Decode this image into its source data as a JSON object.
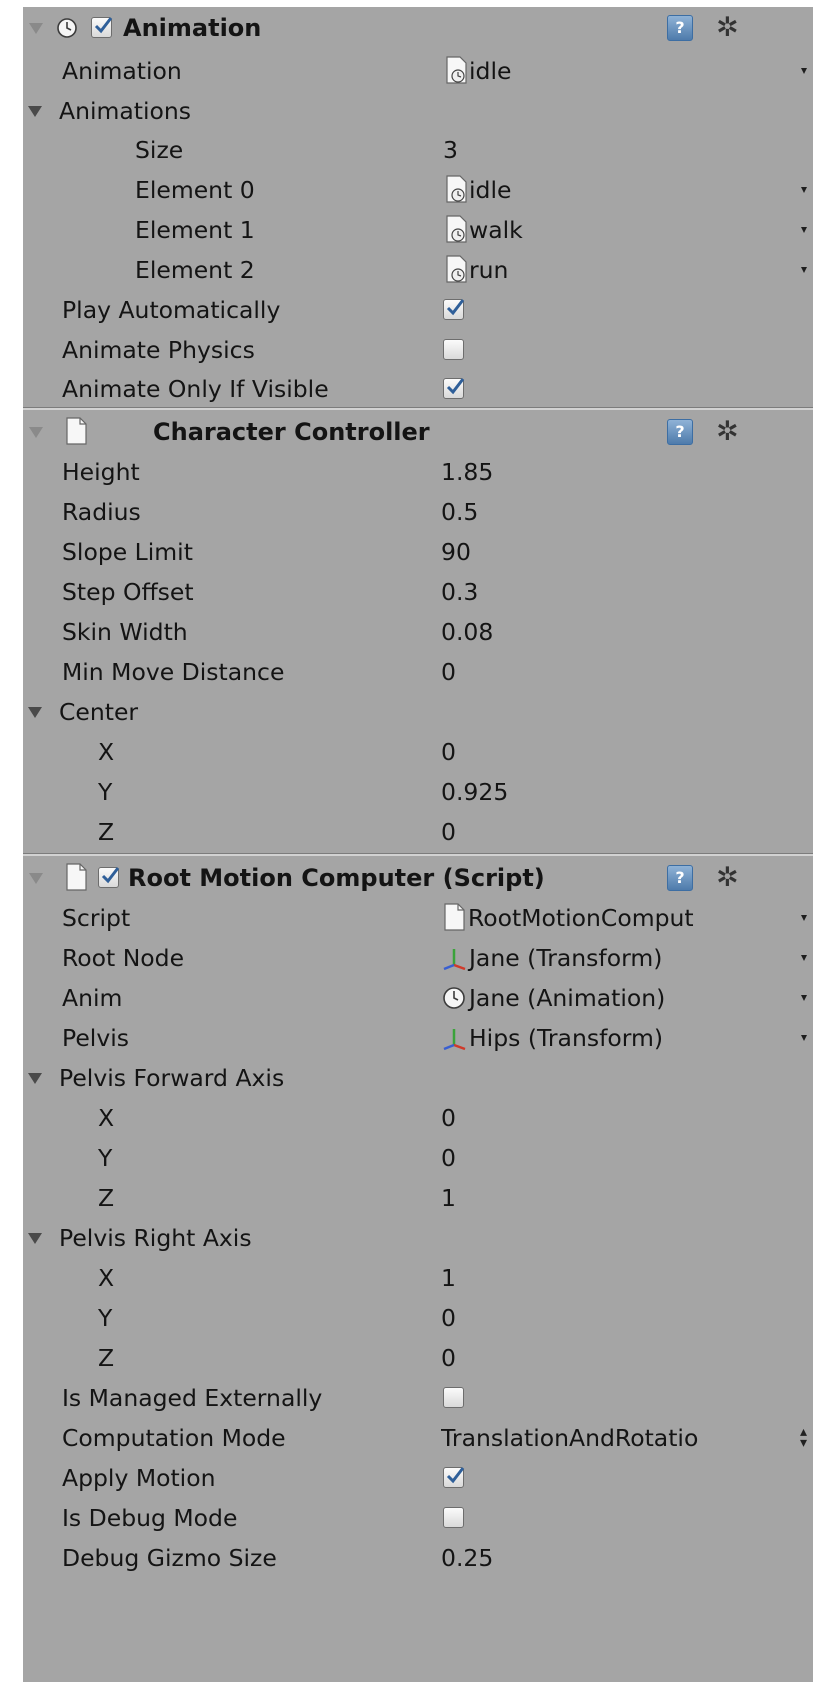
{
  "animation": {
    "title": "Animation",
    "enabled": true,
    "fields": {
      "animation_label": "Animation",
      "animation_value": "idle",
      "animations_label": "Animations",
      "size_label": "Size",
      "size_value": "3",
      "elements": [
        {
          "label": "Element 0",
          "value": "idle"
        },
        {
          "label": "Element 1",
          "value": "walk"
        },
        {
          "label": "Element 2",
          "value": "run"
        }
      ],
      "play_automatically_label": "Play Automatically",
      "play_automatically": true,
      "animate_physics_label": "Animate Physics",
      "animate_physics": false,
      "animate_only_if_visible_label": "Animate Only If Visible",
      "animate_only_if_visible": true
    }
  },
  "character_controller": {
    "title": "Character Controller",
    "rows": [
      {
        "label": "Height",
        "value": "1.85"
      },
      {
        "label": "Radius",
        "value": "0.5"
      },
      {
        "label": "Slope Limit",
        "value": "90"
      },
      {
        "label": "Step Offset",
        "value": "0.3"
      },
      {
        "label": "Skin Width",
        "value": "0.08"
      },
      {
        "label": "Min Move Distance",
        "value": "0"
      }
    ],
    "center_label": "Center",
    "center": [
      {
        "label": "X",
        "value": "0"
      },
      {
        "label": "Y",
        "value": "0.925"
      },
      {
        "label": "Z",
        "value": "0"
      }
    ]
  },
  "root_motion": {
    "title": "Root Motion Computer (Script)",
    "enabled": true,
    "script_label": "Script",
    "script_value": "RootMotionComput",
    "root_node_label": "Root Node",
    "root_node_value": "Jane (Transform)",
    "anim_label": "Anim",
    "anim_value": "Jane (Animation)",
    "pelvis_label": "Pelvis",
    "pelvis_value": "Hips (Transform)",
    "pelvis_forward_label": "Pelvis Forward Axis",
    "pelvis_forward": [
      {
        "label": "X",
        "value": "0"
      },
      {
        "label": "Y",
        "value": "0"
      },
      {
        "label": "Z",
        "value": "1"
      }
    ],
    "pelvis_right_label": "Pelvis Right Axis",
    "pelvis_right": [
      {
        "label": "X",
        "value": "1"
      },
      {
        "label": "Y",
        "value": "0"
      },
      {
        "label": "Z",
        "value": "0"
      }
    ],
    "is_managed_externally_label": "Is Managed Externally",
    "is_managed_externally": false,
    "computation_mode_label": "Computation Mode",
    "computation_mode_value": "TranslationAndRotatio",
    "apply_motion_label": "Apply Motion",
    "apply_motion": true,
    "is_debug_mode_label": "Is Debug Mode",
    "is_debug_mode": false,
    "debug_gizmo_size_label": "Debug Gizmo Size",
    "debug_gizmo_size_value": "0.25"
  },
  "icons": {
    "help": "help-book-icon",
    "gear": "gear-icon",
    "help_glyph": "?",
    "gear_glyph": "✲"
  },
  "colors": {
    "panel_bg": "#a5a5a5",
    "checkbox_check": "#2f5f99"
  }
}
